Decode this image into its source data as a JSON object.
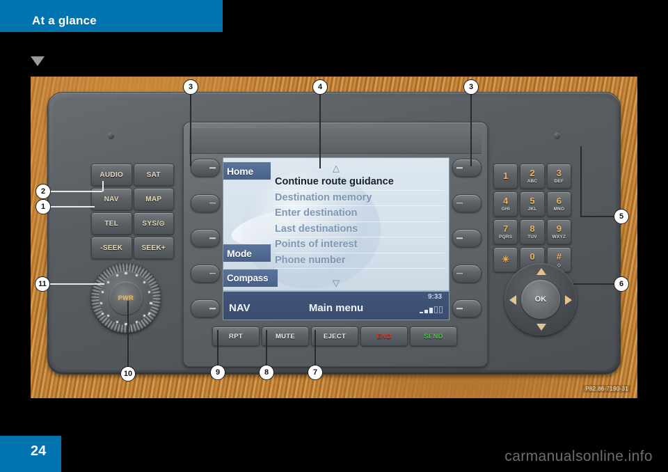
{
  "header": {
    "chapter_title": "At a glance",
    "section_marker_icon": "triangle-down-icon"
  },
  "figure": {
    "image_code": "P82.86-7190-31",
    "left_keys": [
      {
        "label": "AUDIO"
      },
      {
        "label": "SAT"
      },
      {
        "label": "NAV"
      },
      {
        "label": "MAP"
      },
      {
        "label": "TEL"
      },
      {
        "label": "SYS/⊙"
      },
      {
        "label": "-SEEK"
      },
      {
        "label": "SEEK+"
      }
    ],
    "power_knob": {
      "label": "PWR"
    },
    "keypad": [
      {
        "digit": "1",
        "letters": ""
      },
      {
        "digit": "2",
        "letters": "ABC"
      },
      {
        "digit": "3",
        "letters": "DEF"
      },
      {
        "digit": "4",
        "letters": "GHI"
      },
      {
        "digit": "5",
        "letters": "JKL"
      },
      {
        "digit": "6",
        "letters": "MNO"
      },
      {
        "digit": "7",
        "letters": "PQRS"
      },
      {
        "digit": "8",
        "letters": "TUV"
      },
      {
        "digit": "9",
        "letters": "WXYZ"
      },
      {
        "digit": "✳",
        "letters": ""
      },
      {
        "digit": "0",
        "letters": "␣"
      },
      {
        "digit": "#",
        "letters": "◇"
      }
    ],
    "ok_controller": {
      "label": "OK"
    },
    "bottom_keys": [
      {
        "label": "RPT",
        "color": "#e9edf1"
      },
      {
        "label": "MUTE",
        "color": "#e9edf1"
      },
      {
        "label": "EJECT",
        "color": "#e9edf1"
      },
      {
        "label": "END",
        "color": "#e8372e"
      },
      {
        "label": "SEND",
        "color": "#4fc24f"
      }
    ],
    "screen": {
      "tabs": [
        {
          "label": "Home"
        },
        {
          "label": ""
        },
        {
          "label": ""
        },
        {
          "label": "Mode"
        },
        {
          "label": "Compass"
        }
      ],
      "scroll_up_icon": "△",
      "scroll_down_icon": "▽",
      "menu_items": [
        {
          "label": "Continue route guidance",
          "selected": true
        },
        {
          "label": "Destination memory",
          "selected": false
        },
        {
          "label": "Enter destination",
          "selected": false
        },
        {
          "label": "Last destinations",
          "selected": false
        },
        {
          "label": "Points of interest",
          "selected": false
        },
        {
          "label": "Phone number",
          "selected": false
        }
      ],
      "status_bar": {
        "source": "NAV",
        "title": "Main menu",
        "time": "9:33",
        "signal_icon": "signal-strength-icon"
      }
    },
    "callouts": [
      {
        "number": "1"
      },
      {
        "number": "2"
      },
      {
        "number": "3"
      },
      {
        "number": "4"
      },
      {
        "number": "3"
      },
      {
        "number": "5"
      },
      {
        "number": "6"
      },
      {
        "number": "7"
      },
      {
        "number": "8"
      },
      {
        "number": "9"
      },
      {
        "number": "10"
      },
      {
        "number": "11"
      }
    ]
  },
  "footer": {
    "page_number": "24",
    "watermark": "carmanualsonline.info"
  },
  "colors": {
    "brand_blue": "#0073b1",
    "end_red": "#e8372e",
    "send_green": "#4fc24f",
    "tab_blue": "#47618a"
  }
}
